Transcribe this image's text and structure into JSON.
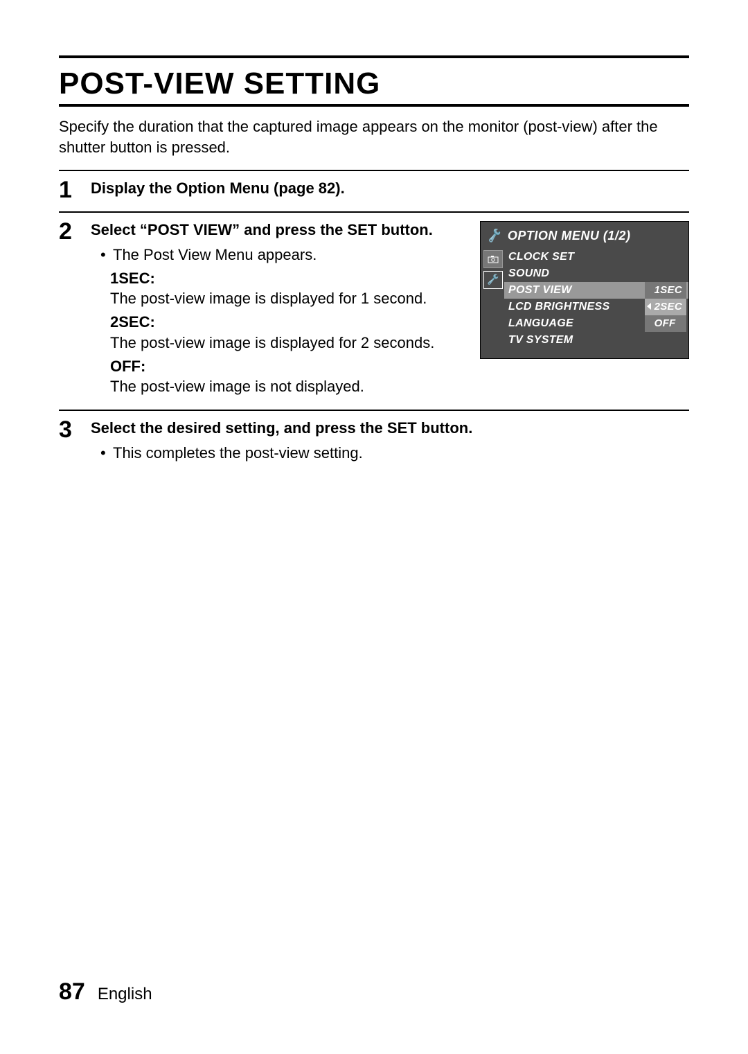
{
  "title": "POST-VIEW SETTING",
  "intro": "Specify the duration that the captured image appears on the monitor (post-view) after the shutter button is pressed.",
  "steps": {
    "s1": {
      "num": "1",
      "head": "Display the Option Menu (page 82)."
    },
    "s2": {
      "num": "2",
      "head": "Select “POST VIEW” and press the SET button.",
      "bullet": "The Post View Menu appears.",
      "opts": {
        "a": {
          "label": "1SEC:",
          "desc": "The post-view image is displayed for 1 second."
        },
        "b": {
          "label": "2SEC:",
          "desc": "The post-view image is displayed for 2 seconds."
        },
        "c": {
          "label": "OFF:",
          "desc": "The post-view image is not displayed."
        }
      }
    },
    "s3": {
      "num": "3",
      "head": "Select the desired setting, and press the SET button.",
      "bullet": "This completes the post-view setting."
    }
  },
  "osd": {
    "title": "OPTION MENU (1/2)",
    "rows": {
      "r1": "CLOCK SET",
      "r2": "SOUND",
      "r3": "POST VIEW",
      "r4": "LCD BRIGHTNESS",
      "r5": "LANGUAGE",
      "r6": "TV SYSTEM"
    },
    "popup": {
      "p1": "1SEC",
      "p2": "2SEC",
      "p3": "OFF"
    }
  },
  "footer": {
    "page": "87",
    "lang": "English"
  }
}
